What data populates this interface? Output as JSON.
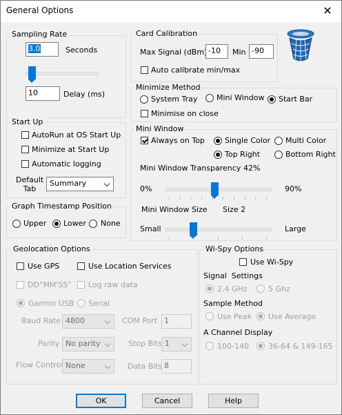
{
  "window": {
    "title": "General Options",
    "close_glyph": "✕"
  },
  "sampling": {
    "legend": "Sampling Rate",
    "rate_value": "3.0",
    "seconds_label": "Seconds",
    "delay_value": "10",
    "delay_label": "Delay (ms)"
  },
  "startup": {
    "legend": "Start Up",
    "autorun_label": "AutoRun at OS Start Up",
    "minimize_label": "Minimize at Start Up",
    "logging_label": "Automatic logging",
    "default_tab_label": "Default Tab",
    "default_tab_value": "Summary"
  },
  "graph_ts": {
    "legend": "Graph Timestamp Position",
    "upper_label": "Upper",
    "lower_label": "Lower",
    "none_label": "None"
  },
  "calibration": {
    "legend": "Card Calibration",
    "max_label": "Max Signal (dBm)",
    "max_value": "-10",
    "min_label": "Min",
    "min_value": "-90",
    "auto_label": "Auto calibrate min/max"
  },
  "minimize_method": {
    "legend": "Minimize Method",
    "system_tray_label": "System Tray",
    "mini_window_label": "Mini Window",
    "start_bar_label": "Start Bar",
    "close_label": "Minimise on close"
  },
  "mini_window": {
    "legend": "Mini Window",
    "always_on_top_label": "Always on Top",
    "single_color_label": "Single Color",
    "multi_color_label": "Multi Color",
    "top_right_label": "Top Right",
    "bottom_right_label": "Bottom Right",
    "transparency_label": "Mini Window Transparency",
    "transparency_value": "42%",
    "transparency_min": "0%",
    "transparency_max": "90%",
    "transparency_fraction": 0.47,
    "size_label": "Mini Window Size",
    "size_value": "Size 2",
    "size_min": "Small",
    "size_max": "Large",
    "size_fraction": 0.25
  },
  "geo": {
    "legend": "Geolocation Options",
    "use_gps_label": "Use GPS",
    "location_services_label": "Use Location Services",
    "dd_label": "DD°MM'SS\"",
    "log_raw_label": "Log raw data",
    "garmin_label": "Garmin USB",
    "serial_label": "Serial",
    "baud_label": "Baud Rate",
    "baud_value": "4800",
    "com_label": "COM Port",
    "com_value": "1",
    "parity_label": "Parity",
    "parity_value": "No parity",
    "stop_label": "Stop Bits",
    "stop_value": "1",
    "flow_label": "Flow Control",
    "flow_value": "None",
    "data_bits_label": "Data Bits",
    "data_bits_value": "8"
  },
  "wispy": {
    "legend": "Wi-Spy Options",
    "use_label": "Use Wi-Spy",
    "signal_settings_label": "Signal  Settings",
    "ghz24_label": "2.4 GHz",
    "ghz5_label": "5 Ghz",
    "sample_method_label": "Sample Method",
    "peak_label": "Use Peak",
    "average_label": "Use Average",
    "channel_display_label": "A Channel Display",
    "ch_100_label": "100-140",
    "ch_36_label": "36-64 & 149-165"
  },
  "buttons": {
    "ok": "OK",
    "cancel": "Cancel",
    "help": "Help"
  },
  "colors": {
    "accent": "#0078d7",
    "selection": "#0078d7"
  }
}
